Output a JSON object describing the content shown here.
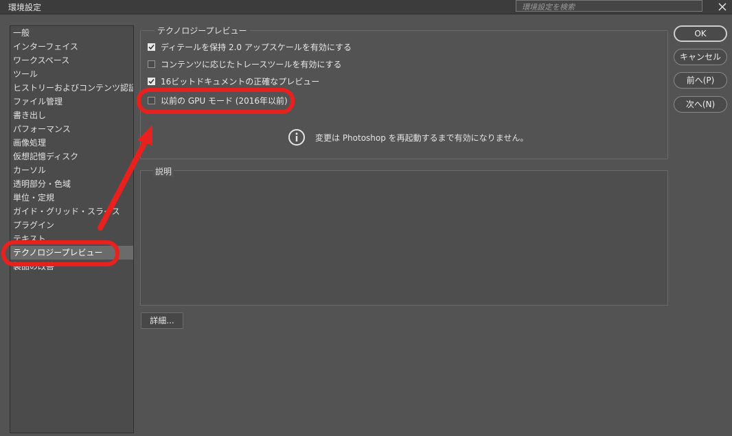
{
  "window": {
    "title": "環境設定",
    "search_placeholder": "環境設定を検索"
  },
  "sidebar": {
    "items": [
      {
        "label": "一般"
      },
      {
        "label": "インターフェイス"
      },
      {
        "label": "ワークスペース"
      },
      {
        "label": "ツール"
      },
      {
        "label": "ヒストリーおよびコンテンツ認証情報"
      },
      {
        "label": "ファイル管理"
      },
      {
        "label": "書き出し"
      },
      {
        "label": "パフォーマンス"
      },
      {
        "label": "画像処理"
      },
      {
        "label": "仮想記憶ディスク"
      },
      {
        "label": "カーソル"
      },
      {
        "label": "透明部分・色域"
      },
      {
        "label": "単位・定規"
      },
      {
        "label": "ガイド・グリッド・スライス"
      },
      {
        "label": "プラグイン"
      },
      {
        "label": "テキスト"
      },
      {
        "label": "テクノロジープレビュー"
      },
      {
        "label": "製品の改善"
      }
    ],
    "selected_index": 16
  },
  "tech_preview": {
    "group_title": "テクノロジープレビュー",
    "options": [
      {
        "label": "ディテールを保持 2.0 アップスケールを有効にする",
        "checked": true
      },
      {
        "label": "コンテンツに応じたトレースツールを有効にする",
        "checked": false
      },
      {
        "label": "16ビットドキュメントの正確なプレビュー",
        "checked": true
      },
      {
        "label": "以前の GPU モード (2016年以前)",
        "checked": false
      }
    ],
    "notice": "変更は Photoshop を再起動するまで有効になりません。"
  },
  "description": {
    "title": "説明"
  },
  "buttons": {
    "detail": "詳細...",
    "ok": "OK",
    "cancel": "キャンセル",
    "prev": "前へ(P)",
    "next": "次へ(N)"
  },
  "colors": {
    "annotation": "#e8201e",
    "background": "#535353"
  }
}
